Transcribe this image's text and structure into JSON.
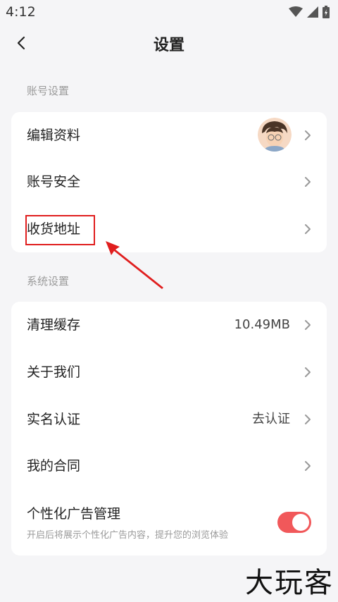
{
  "status_bar": {
    "time": "4:12"
  },
  "header": {
    "title": "设置"
  },
  "sections": {
    "account": {
      "title": "账号设置",
      "items": [
        {
          "label": "编辑资料"
        },
        {
          "label": "账号安全"
        },
        {
          "label": "收货地址"
        }
      ]
    },
    "system": {
      "title": "系统设置",
      "items": [
        {
          "label": "清理缓存",
          "value": "10.49MB"
        },
        {
          "label": "关于我们"
        },
        {
          "label": "实名认证",
          "value": "去认证"
        },
        {
          "label": "我的合同"
        }
      ],
      "ad": {
        "label": "个性化广告管理",
        "description": "开启后将展示个性化广告内容，提升您的浏览体验",
        "enabled": true
      }
    }
  },
  "watermark": "大玩客",
  "colors": {
    "accent": "#f1585a",
    "highlight": "#e01e1e",
    "background": "#f5f5f7"
  }
}
